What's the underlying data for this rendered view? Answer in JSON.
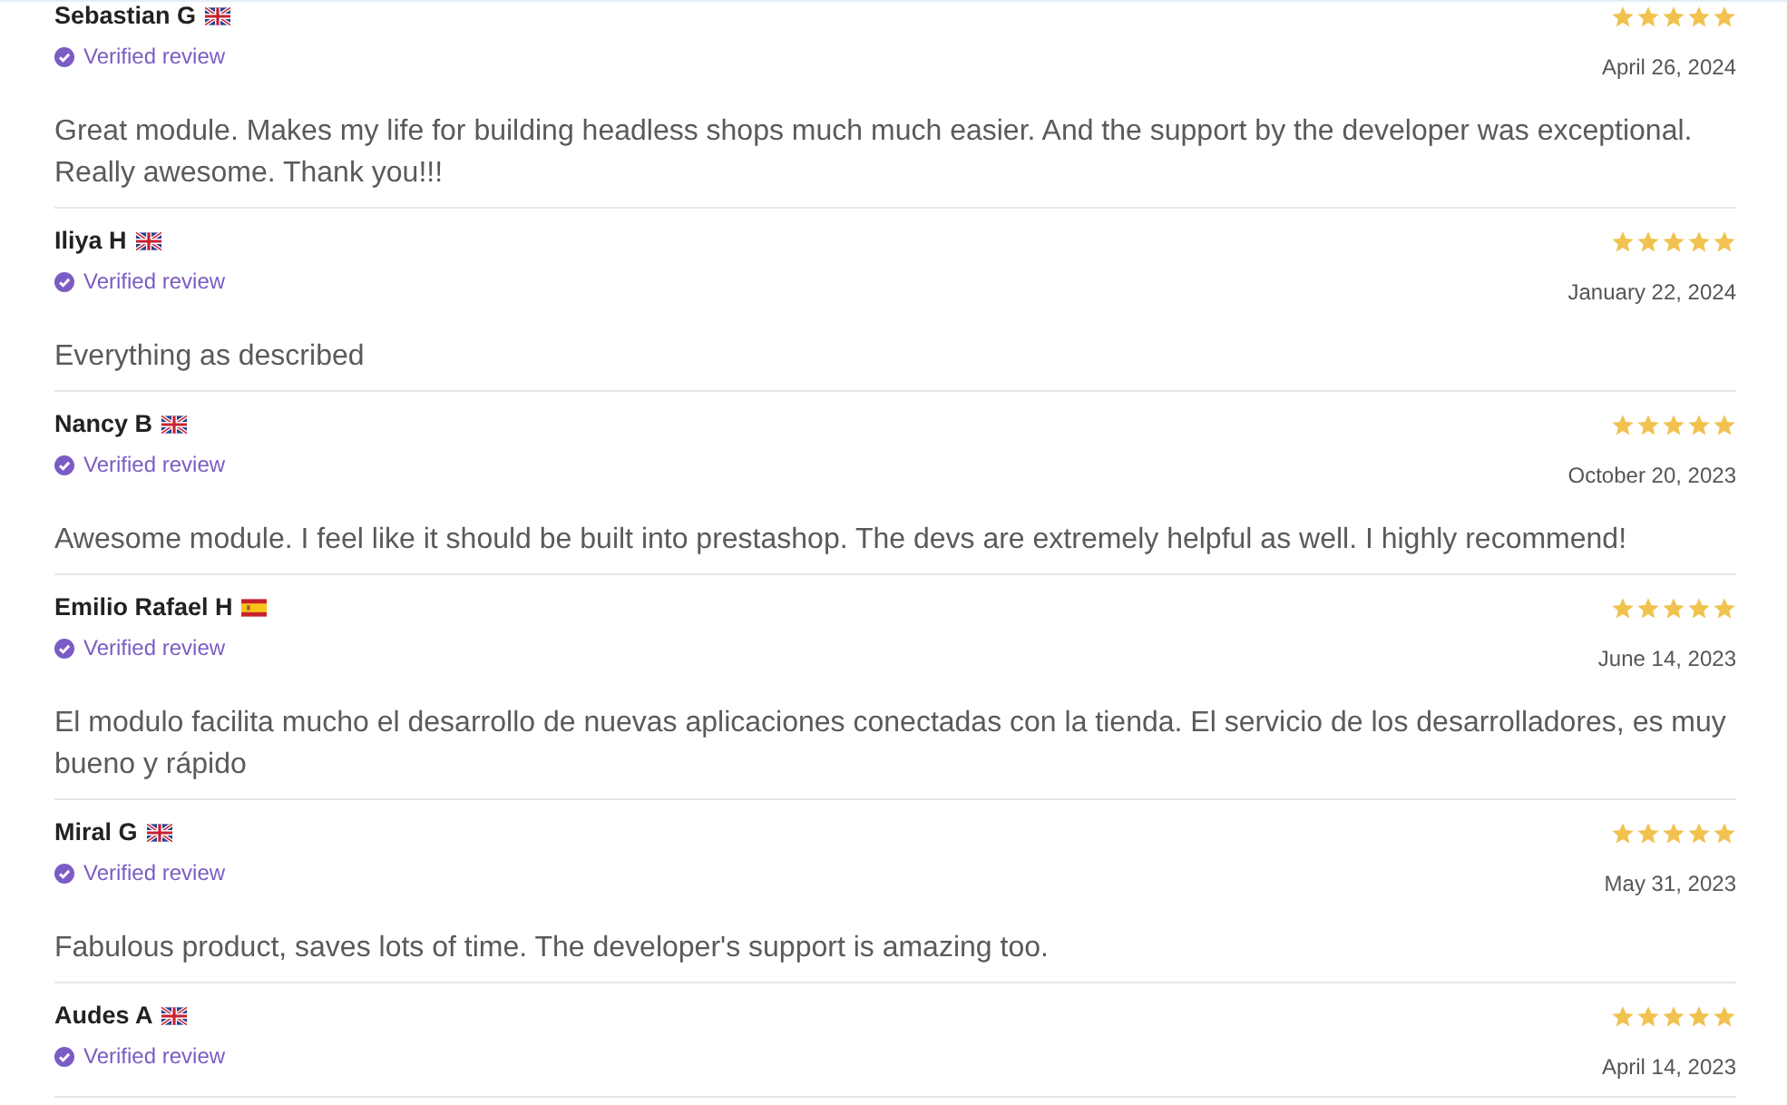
{
  "reviews": [
    {
      "author": "Sebastian G",
      "kind": "gb",
      "verified": "Verified review",
      "stars": 5,
      "date": "April 26, 2024",
      "text": "Great module. Makes my life for building headless shops much much easier. And the support by the developer was exceptional. Really awesome. Thank you!!!"
    },
    {
      "author": "Iliya H",
      "kind": "gb",
      "verified": "Verified review",
      "stars": 5,
      "date": "January 22, 2024",
      "text": "Everything as described"
    },
    {
      "author": "Nancy B",
      "kind": "gb",
      "verified": "Verified review",
      "stars": 5,
      "date": "October 20, 2023",
      "text": "Awesome module. I feel like it should be built into prestashop. The devs are extremely helpful as well. I highly recommend!"
    },
    {
      "author": "Emilio Rafael H",
      "kind": "es",
      "verified": "Verified review",
      "stars": 5,
      "date": "June 14, 2023",
      "text": "El modulo facilita mucho el desarrollo de nuevas aplicaciones conectadas con la tienda. El servicio de los desarrolladores, es muy bueno y rápido"
    },
    {
      "author": "Miral G",
      "kind": "gb",
      "verified": "Verified review",
      "stars": 5,
      "date": "May 31, 2023",
      "text": "Fabulous product, saves lots of time. The developer's support is amazing too."
    },
    {
      "author": "Audes A",
      "kind": "gb",
      "verified": "Verified review",
      "stars": 5,
      "date": "April 14, 2023"
    }
  ]
}
